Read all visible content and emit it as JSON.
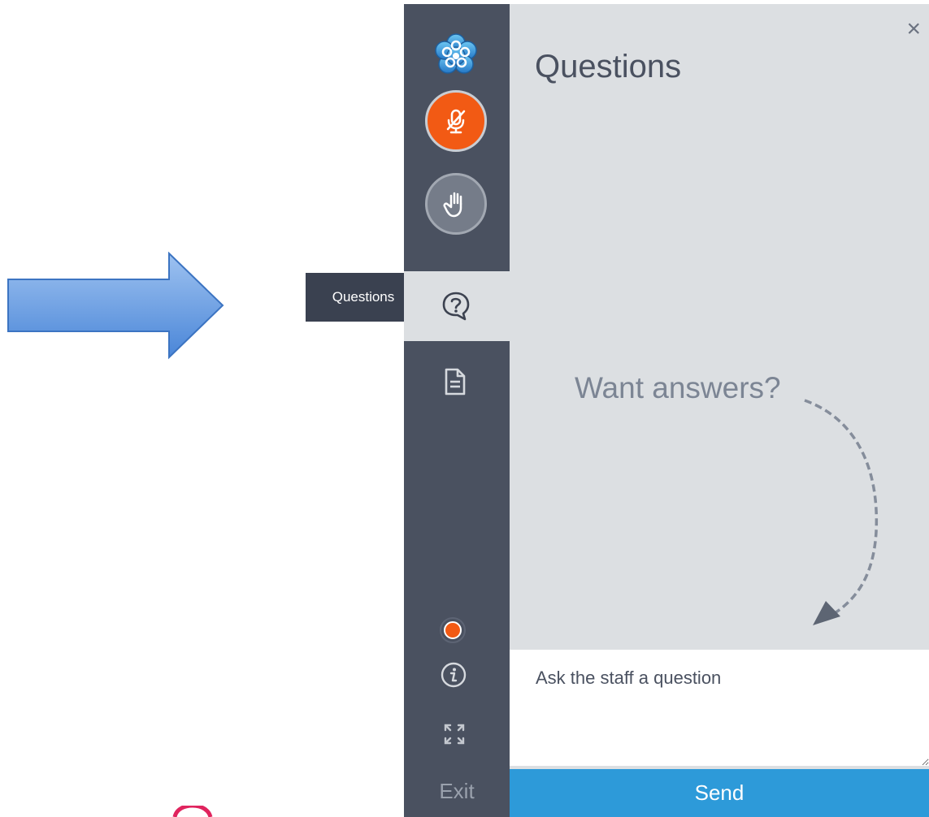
{
  "tooltip": {
    "text": "Questions"
  },
  "sidebar": {
    "items": [
      {
        "name": "app-logo",
        "icon": "flower-logo-icon"
      },
      {
        "name": "mute-microphone",
        "icon": "mic-muted-icon",
        "color": "#f25a14"
      },
      {
        "name": "raise-hand",
        "icon": "hand-icon"
      },
      {
        "name": "questions",
        "icon": "question-bubble-icon",
        "active": true
      },
      {
        "name": "handouts",
        "icon": "document-icon"
      },
      {
        "name": "status",
        "icon": "status-dot-icon",
        "color": "#f25a14"
      },
      {
        "name": "info",
        "icon": "info-icon"
      },
      {
        "name": "fullscreen",
        "icon": "expand-icon"
      }
    ],
    "exit_label": "Exit"
  },
  "panel": {
    "title": "Questions",
    "close_label": "×",
    "hint": "Want answers?",
    "input_placeholder": "Ask the staff a question",
    "send_label": "Send"
  },
  "colors": {
    "sidebar_bg": "#4a5160",
    "panel_bg": "#dcdfe2",
    "accent_orange": "#f25a14",
    "send_blue": "#2d9ad9"
  }
}
